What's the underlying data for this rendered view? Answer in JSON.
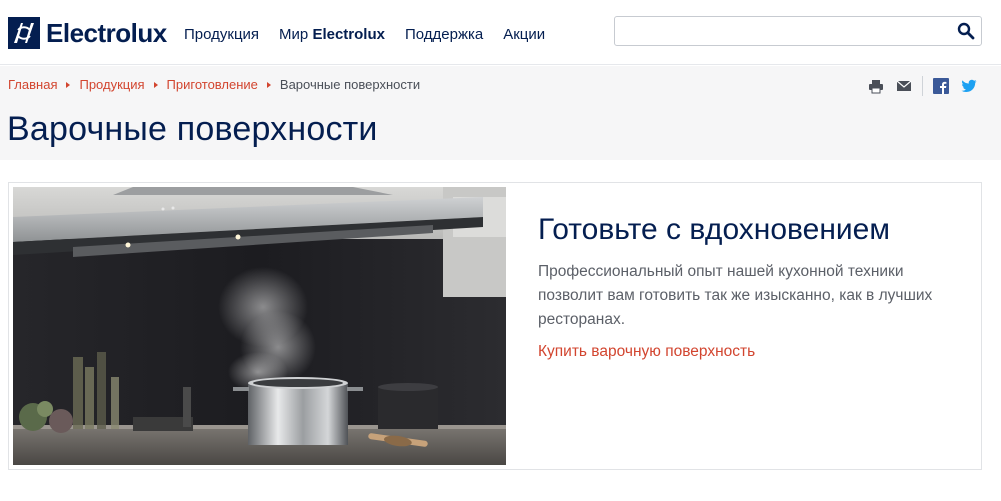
{
  "brand": {
    "name": "Electrolux"
  },
  "nav": {
    "items": [
      {
        "label": "Продукция"
      },
      {
        "label_prefix": "Мир ",
        "label_bold": "Electrolux"
      },
      {
        "label": "Поддержка"
      },
      {
        "label": "Акции"
      }
    ]
  },
  "search": {
    "placeholder": "",
    "value": ""
  },
  "breadcrumb": {
    "items": [
      "Главная",
      "Продукция",
      "Приготовление"
    ],
    "current": "Варочные поверхности"
  },
  "page": {
    "title": "Варочные поверхности"
  },
  "share": {
    "icons": [
      "print-icon",
      "email-icon",
      "facebook-icon",
      "twitter-icon"
    ]
  },
  "promo": {
    "title": "Готовьте с вдохновением",
    "text": "Профессиональный опыт нашей кухонной техники позволит вам готовить так же изысканно, как в лучших ресторанах.",
    "link": "Купить варочную поверхность"
  },
  "colors": {
    "brand_navy": "#041e50",
    "accent_red": "#d2452f",
    "band_gray": "#f6f6f7",
    "twitter_blue": "#1da1f2",
    "facebook_blue": "#3b5998"
  }
}
